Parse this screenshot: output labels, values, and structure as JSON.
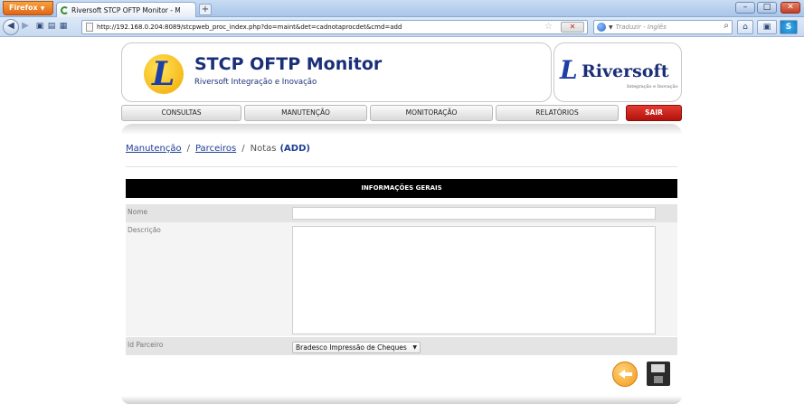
{
  "browser": {
    "menu_button": "Firefox",
    "tab_title": "Riversoft STCP OFTP Monitor - Manuten...",
    "new_tab": "+",
    "url": "http://192.168.0.204:8089/stcpweb_proc_index.php?do=maint&det=cadnotaprocdet&cmd=add",
    "search_placeholder": "Traduzir - Inglês"
  },
  "header": {
    "app_title": "STCP OFTP Monitor",
    "app_subtitle": "Riversoft Integração e Inovação",
    "brand_name": "Riversoft",
    "brand_tagline": "Integração e Inovação"
  },
  "menu": {
    "consultas": "CONSULTAS",
    "manutencao": "MANUTENÇÃO",
    "monitoracao": "MONITORAÇÃO",
    "relatorios": "RELATÓRIOS",
    "sair": "SAIR"
  },
  "breadcrumb": {
    "level1": "Manutenção",
    "level2": "Parceiros",
    "current": "Notas",
    "mode": "(ADD)",
    "separator": "/"
  },
  "form": {
    "section_title": "INFORMAÇÕES GERAIS",
    "nome_label": "Nome",
    "nome_value": "",
    "descricao_label": "Descrição",
    "descricao_value": "",
    "parceiro_label": "Id Parceiro",
    "parceiro_selected": "Bradesco Impressão de Cheques"
  },
  "colors": {
    "brand_blue": "#1a2f78",
    "link_blue": "#1f3e94",
    "sair_red": "#c8201a",
    "back_orange": "#f29a1a"
  },
  "icons": {
    "back_action": "back-arrow-circle-icon",
    "save_action": "floppy-disk-icon"
  }
}
